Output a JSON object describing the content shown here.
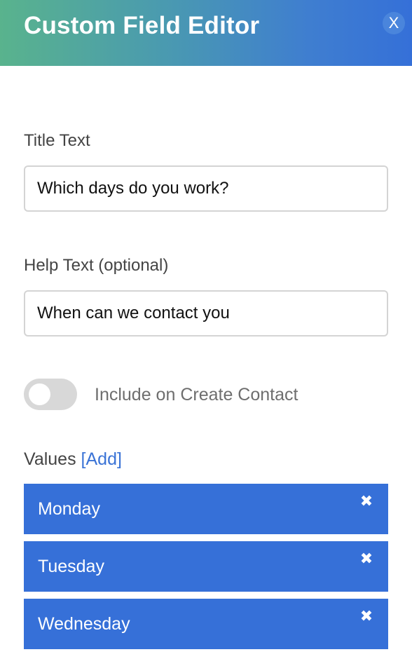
{
  "header": {
    "title": "Custom Field Editor",
    "close_label": "X"
  },
  "title_field": {
    "label": "Title Text",
    "value": "Which days do you work?"
  },
  "help_field": {
    "label": "Help Text (optional)",
    "value": "When can we contact you"
  },
  "include_toggle": {
    "label": "Include on Create Contact",
    "checked": false
  },
  "values_section": {
    "label": "Values",
    "add_label": "[Add]",
    "items": [
      {
        "label": "Monday",
        "remove_icon": "✖"
      },
      {
        "label": "Tuesday",
        "remove_icon": "✖"
      },
      {
        "label": "Wednesday",
        "remove_icon": "✖"
      }
    ]
  },
  "colors": {
    "accent": "#3670d8",
    "header_gradient_start": "#59b38d",
    "header_gradient_end": "#3570d8"
  }
}
